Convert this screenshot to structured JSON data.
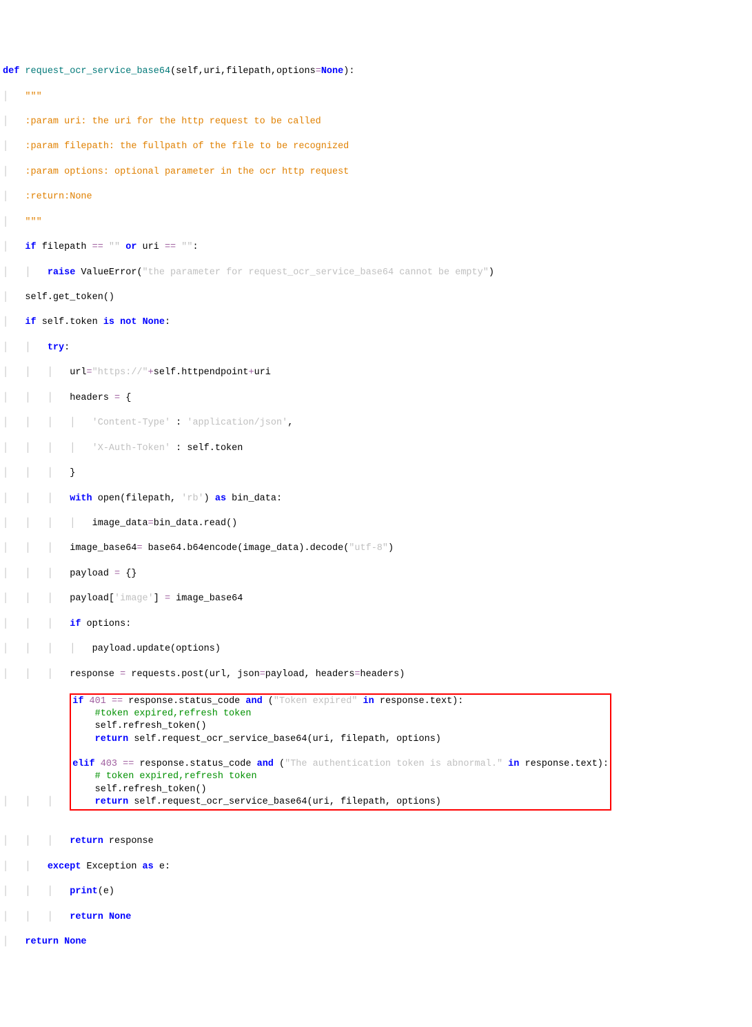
{
  "code": {
    "l01_def": "def",
    "l01_fn": "request_ocr_service_base64",
    "l01_params": "(self,uri,filepath,options",
    "l01_eq": "=",
    "l01_none": "None",
    "l01_close": "):",
    "l02_q": "\"\"\"",
    "l03": ":param uri: the uri for the http request to be called",
    "l04": ":param filepath: the fullpath of the file to be recognized",
    "l05": ":param options: optional parameter in the ocr http request",
    "l06": ":return:None",
    "l07_q": "\"\"\"",
    "l08_if": "if",
    "l08_a": " filepath ",
    "l08_eq": "==",
    "l08_s1": " \"\" ",
    "l08_or": "or",
    "l08_b": " uri ",
    "l08_s2": " \"\"",
    "l08_c": ":",
    "l09_raise": "raise",
    "l09_txt": " ValueError(",
    "l09_str": "\"the parameter for request_ocr_service_base64 cannot be empty\"",
    "l09_cl": ")",
    "l10": "self.get_token()",
    "l11_if": "if",
    "l11_a": " self.token ",
    "l11_is": "is",
    "l11_sp": " ",
    "l11_not": "not",
    "l11_b": " ",
    "l11_none": "None",
    "l11_c": ":",
    "l12_try": "try",
    "l12_c": ":",
    "l13_a": "url",
    "l13_eq": "=",
    "l13_s": "\"https://\"",
    "l13_p": "+",
    "l13_b": "self.httpendpoint",
    "l13_c": "uri",
    "l14_a": "headers ",
    "l14_eq": "=",
    "l14_b": " {",
    "l15_s1": "'Content-Type'",
    "l15_c": " : ",
    "l15_s2": "'application/json'",
    "l15_co": ",",
    "l16_s1": "'X-Auth-Token'",
    "l16_c": " : self.token",
    "l17": "}",
    "l18_with": "with",
    "l18_a": " open(filepath, ",
    "l18_s": "'rb'",
    "l18_b": ") ",
    "l18_as": "as",
    "l18_c": " bin_data:",
    "l19_a": "image_data",
    "l19_eq": "=",
    "l19_b": "bin_data.read()",
    "l20_a": "image_base64",
    "l20_eq": "=",
    "l20_b": " base64.b64encode(image_data).decode(",
    "l20_s": "\"utf-8\"",
    "l20_c": ")",
    "l21_a": "payload ",
    "l21_eq": "=",
    "l21_b": " {}",
    "l22_a": "payload[",
    "l22_s": "'image'",
    "l22_b": "] ",
    "l22_eq": "=",
    "l22_c": " image_base64",
    "l23_if": "if",
    "l23_a": " options:",
    "l24": "payload.update(options)",
    "l25_a": "response ",
    "l25_eq": "=",
    "l25_b": " requests.post(url, json",
    "l25_c": "payload, headers",
    "l25_d": "headers)",
    "l26_if": "if",
    "l26_a": " ",
    "l26_n": "401",
    "l26_sp": " ",
    "l26_eq": "==",
    "l26_b": " response.status_code ",
    "l26_and": "and",
    "l26_c": " (",
    "l26_s": "\"Token expired\"",
    "l26_sp2": " ",
    "l26_in": "in",
    "l26_d": " response.text):",
    "l27": "#token expired,refresh token",
    "l28": "self.refresh_token()",
    "l29_ret": "return",
    "l29_a": " self.request_ocr_service_base64(uri, filepath, options)",
    "l30": "",
    "l31_elif": "elif",
    "l31_a": " ",
    "l31_n": "403",
    "l31_sp": " ",
    "l31_eq": "==",
    "l31_b": " response.status_code ",
    "l31_and": "and",
    "l31_c": " (",
    "l31_s": "\"The authentication token is abnormal.\"",
    "l31_sp2": " ",
    "l31_in": "in",
    "l31_d": " response.text):",
    "l32": "# token expired,refresh token",
    "l33": "self.refresh_token()",
    "l34_ret": "return",
    "l34_a": " self.request_ocr_service_base64(uri, filepath, options)",
    "l35": "",
    "l36_ret": "return",
    "l36_a": " response",
    "l37_exc": "except",
    "l37_a": " Exception ",
    "l37_as": "as",
    "l37_b": " e:",
    "l38_pr": "print",
    "l38_a": "(e)",
    "l39_ret": "return",
    "l39_none": "None",
    "l40_ret": "return",
    "l40_none": "None"
  },
  "indent": {
    "g1": "│   ",
    "g2": "│   │   ",
    "g3": "│   │   │   ",
    "g4": "│   │   │   │   ",
    "g5": "│   │   │   │   │   "
  },
  "highlight_box_lines": "26-34"
}
